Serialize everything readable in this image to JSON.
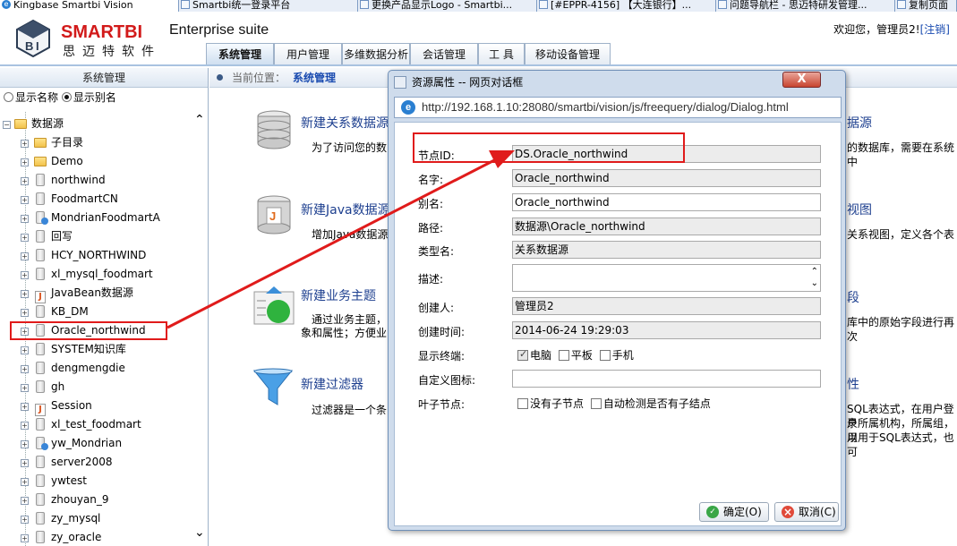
{
  "browser_tabs": [
    {
      "label": "Kingbase Smartbi Vision",
      "icon": "ie-icon",
      "active": true
    },
    {
      "label": "Smartbi统一登录平台",
      "icon": "page-icon"
    },
    {
      "label": "更换产品显示Logo - Smartbi...",
      "icon": "page-icon"
    },
    {
      "label": "[#EPPR-4156] 【大连银行】...",
      "icon": "page-icon"
    },
    {
      "label": "问题导航栏 - 思迈特研发管理...",
      "icon": "page-icon"
    },
    {
      "label": "复制页面",
      "icon": "page-icon"
    }
  ],
  "header": {
    "brand": "SMARTBI",
    "brand_cn": "思迈特软件",
    "suite": "Enterprise suite",
    "welcome": "欢迎您，管理员2!",
    "logout": "[注销]"
  },
  "nav_tabs": [
    {
      "label": "系统管理",
      "active": true
    },
    {
      "label": "用户管理"
    },
    {
      "label": "多维数据分析"
    },
    {
      "label": "会话管理"
    },
    {
      "label": "工 具"
    },
    {
      "label": "移动设备管理"
    }
  ],
  "left_panel": {
    "title": "系统管理",
    "radio_name": "显示名称",
    "radio_alias": "显示别名",
    "selected_radio": "显示别名",
    "tree_root": "数据源",
    "tree_items": [
      {
        "label": "子目录",
        "icon": "folder"
      },
      {
        "label": "Demo",
        "icon": "folder"
      },
      {
        "label": "northwind",
        "icon": "db"
      },
      {
        "label": "FoodmartCN",
        "icon": "db"
      },
      {
        "label": "MondrianFoodmartA",
        "icon": "mdb"
      },
      {
        "label": "回写",
        "icon": "db"
      },
      {
        "label": "HCY_NORTHWIND",
        "icon": "db"
      },
      {
        "label": "xl_mysql_foodmart",
        "icon": "db"
      },
      {
        "label": "JavaBean数据源",
        "icon": "java"
      },
      {
        "label": "KB_DM",
        "icon": "db"
      },
      {
        "label": "Oracle_northwind",
        "icon": "db",
        "selected": true
      },
      {
        "label": "SYSTEM知识库",
        "icon": "db"
      },
      {
        "label": "dengmengdie",
        "icon": "db"
      },
      {
        "label": "gh",
        "icon": "db"
      },
      {
        "label": "Session",
        "icon": "java"
      },
      {
        "label": "xl_test_foodmart",
        "icon": "db"
      },
      {
        "label": "yw_Mondrian",
        "icon": "mdb"
      },
      {
        "label": "server2008",
        "icon": "db"
      },
      {
        "label": "ywtest",
        "icon": "db"
      },
      {
        "label": "zhouyan_9",
        "icon": "db"
      },
      {
        "label": "zy_mysql",
        "icon": "db"
      },
      {
        "label": "zy_oracle",
        "icon": "db"
      }
    ]
  },
  "breadcrumb": {
    "prefix": "当前位置：",
    "current": "系统管理"
  },
  "features": [
    {
      "title": "新建关系数据源",
      "desc": "为了访问您的数"
    },
    {
      "title": "新建Java数据源",
      "desc": "增加Java数据源"
    },
    {
      "title": "新建业务主题",
      "desc1": "通过业务主题，",
      "desc2": "象和属性；方便业"
    },
    {
      "title": "新建过滤器",
      "desc": "过滤器是一个条"
    }
  ],
  "right_fragments": {
    "r1_title": "据源",
    "r1_desc": "的数据库，需要在系统中",
    "r2_title": "视图",
    "r2_desc": "关系视图，定义各个表",
    "r3_title": "段",
    "r3_desc": "库中的原始字段进行再次",
    "r4_title": "性",
    "r4_desc1": "SQL表达式，在用户登录",
    "r4_desc2": "户所属机构，所属组，用",
    "r4_desc3": "以用于SQL表达式，也可"
  },
  "dialog": {
    "title": "资源属性 -- 网页对话框",
    "url": "http://192.168.1.10:28080/smartbi/vision/js/freequery/dialog/Dialog.html",
    "close": "X",
    "fields": {
      "node_id_label": "节点ID:",
      "node_id": "DS.Oracle_northwind",
      "name_label": "名字:",
      "name": "Oracle_northwind",
      "alias_label": "别名:",
      "alias": "Oracle_northwind",
      "path_label": "路径:",
      "path": "数据源\\Oracle_northwind",
      "type_label": "类型名:",
      "type": "关系数据源",
      "desc_label": "描述:",
      "desc": "",
      "creator_label": "创建人:",
      "creator": "管理员2",
      "created_label": "创建时间:",
      "created": "2014-06-24 19:29:03",
      "terminal_label": "显示终端:",
      "terminal_pc": "电脑",
      "terminal_pad": "平板",
      "terminal_phone": "手机",
      "custom_icon_label": "自定义图标:",
      "custom_icon": "",
      "leaf_label": "叶子节点:",
      "no_child": "没有子节点",
      "auto_detect": "自动检测是否有子结点"
    },
    "ok": "确定(O)",
    "cancel": "取消(C)"
  },
  "colors": {
    "accent": "#1d3f8f",
    "highlight": "#e01b1b",
    "brand": "#d21a1a"
  }
}
